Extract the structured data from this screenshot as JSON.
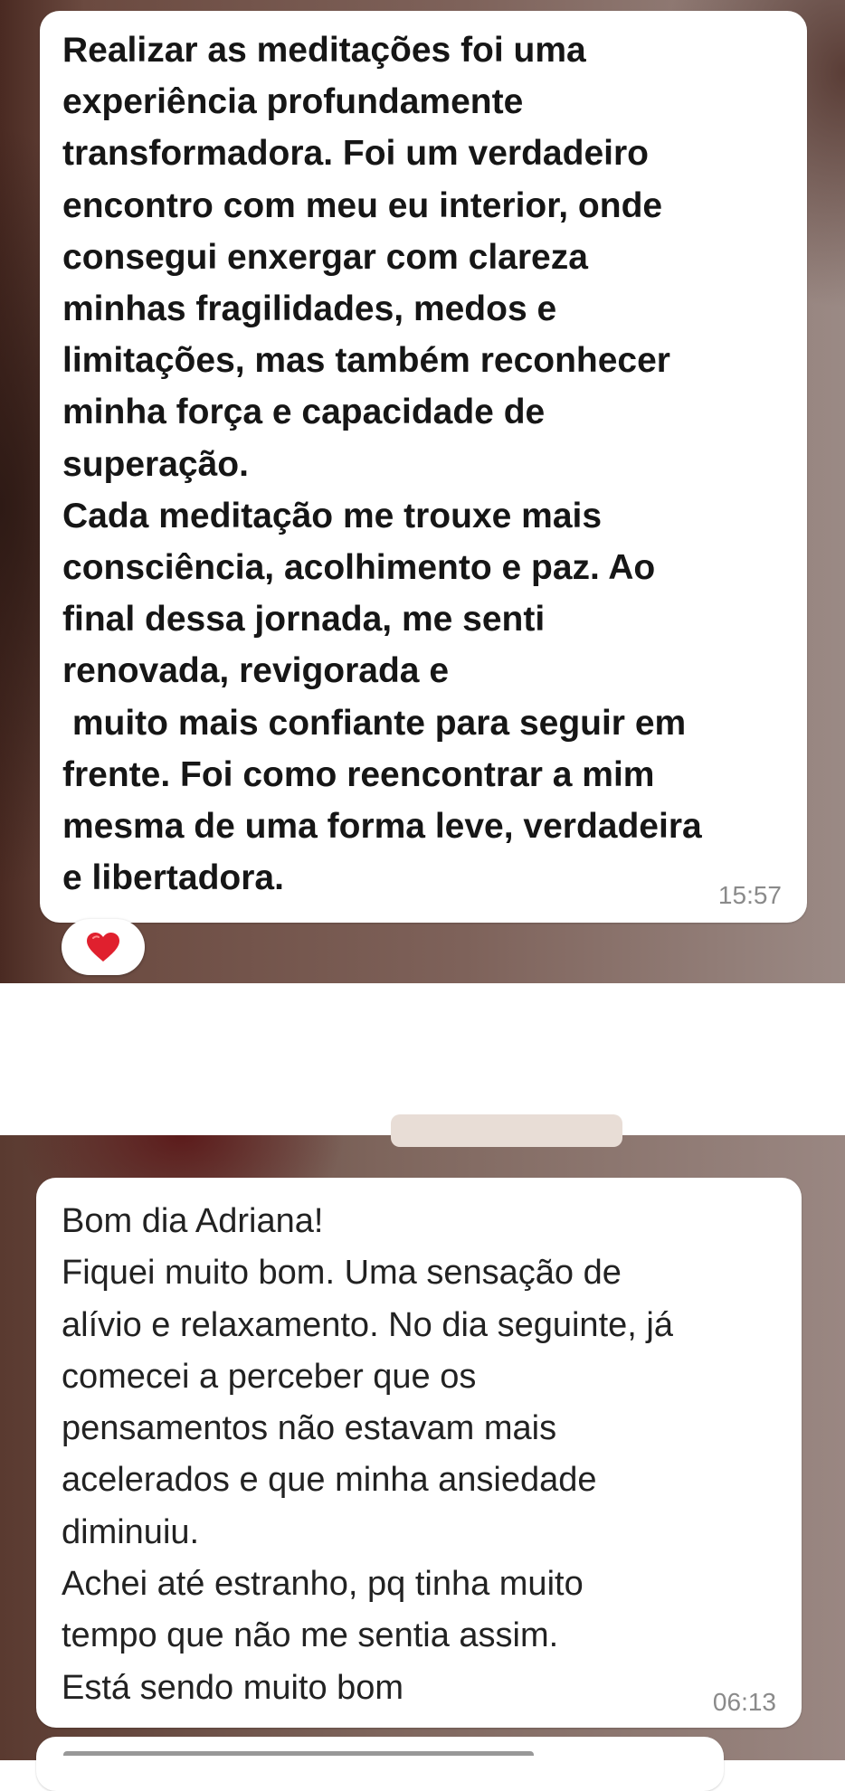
{
  "messages": [
    {
      "text": "Realizar as meditações foi uma\nexperiência profundamente\ntransformadora. Foi um verdadeiro\nencontro com meu eu interior, onde\nconsegui enxergar com clareza\nminhas fragilidades, medos e\nlimitações, mas também reconhecer\nminha força e capacidade de\nsuperação.\nCada meditação me trouxe mais\nconsciência, acolhimento e paz. Ao\nfinal dessa jornada, me senti\nrenovada, revigorada e\n muito mais confiante para seguir em\nfrente. Foi como reencontrar a mim\nmesma de uma forma leve, verdadeira\ne libertadora.",
      "time": "15:57",
      "reaction": "❤️"
    },
    {
      "text": "Bom dia Adriana!\nFiquei muito bom. Uma sensação de\nalívio e relaxamento. No dia seguinte, já\ncomecei a perceber que os\npensamentos não estavam mais\nacelerados e que minha ansiedade\ndiminuiu.\nAchei até estranho, pq tinha muito\ntempo que não me sentia assim.\nEstá sendo muito bom",
      "time": "06:13"
    }
  ],
  "colors": {
    "bubble": "#ffffff",
    "heart": "#e0202e",
    "timestamp": "#8a8a8a"
  }
}
